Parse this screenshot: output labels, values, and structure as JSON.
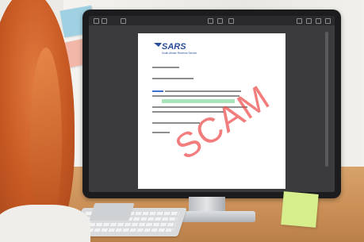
{
  "scene": {
    "monitor": {
      "viewer_title": "",
      "document": {
        "logo_text": "SARS",
        "logo_subtext": "South African Revenue Service"
      },
      "stamp_text": "SCAM"
    }
  },
  "colors": {
    "stamp": "#ec4646",
    "logo": "#2b4c9b",
    "link": "#3d6fd1",
    "highlight": "#96dcaa"
  }
}
